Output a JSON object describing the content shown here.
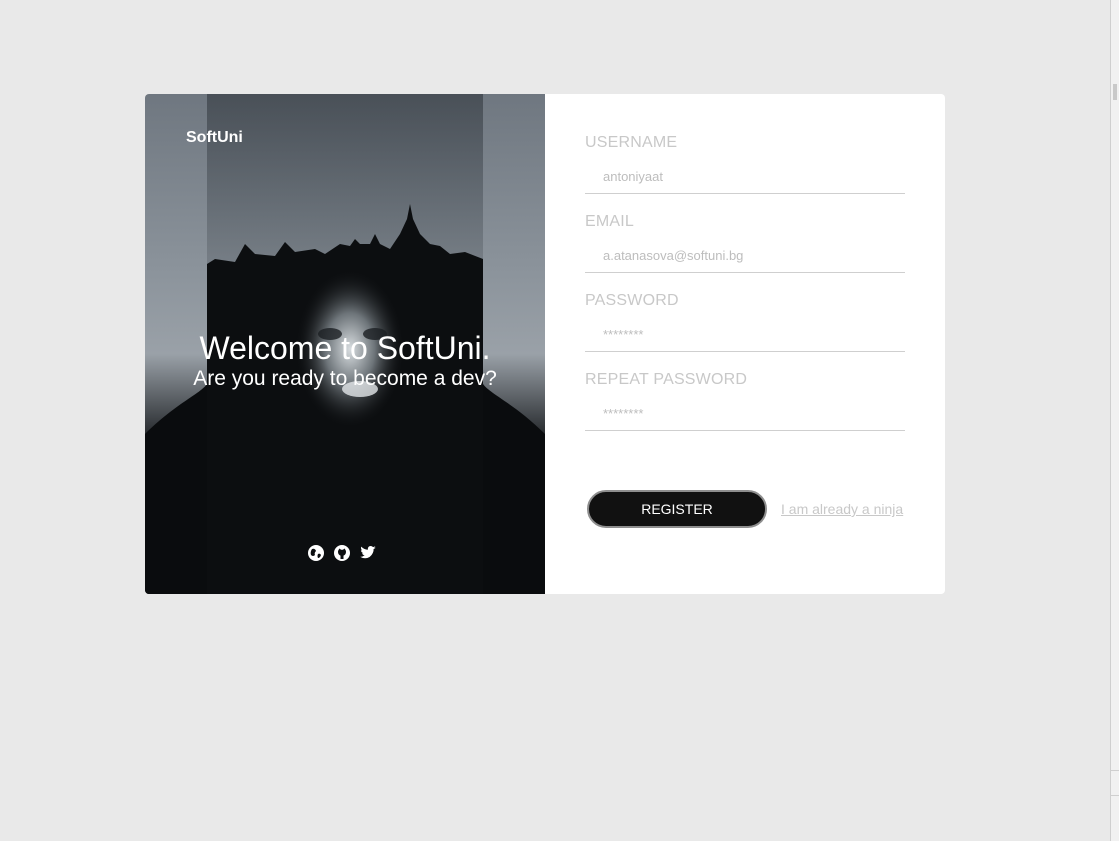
{
  "hero": {
    "brand": "SoftUni",
    "welcome": "Welcome to SoftUni.",
    "tagline": "Are you ready to become a dev?",
    "social_icons": [
      "globe-icon",
      "github-icon",
      "twitter-icon"
    ]
  },
  "form": {
    "username": {
      "label": "USERNAME",
      "value": "antoniyaat"
    },
    "email": {
      "label": "EMAIL",
      "value": "a.atanasova@softuni.bg"
    },
    "password": {
      "label": "PASSWORD",
      "value": "********"
    },
    "repeat_password": {
      "label": "REPEAT PASSWORD",
      "value": "********"
    },
    "register_label": "REGISTER",
    "login_link": "I am already a ninja"
  },
  "colors": {
    "page_bg": "#e9e9e9",
    "button_bg": "#111111",
    "muted_text": "#c8c8c8"
  }
}
